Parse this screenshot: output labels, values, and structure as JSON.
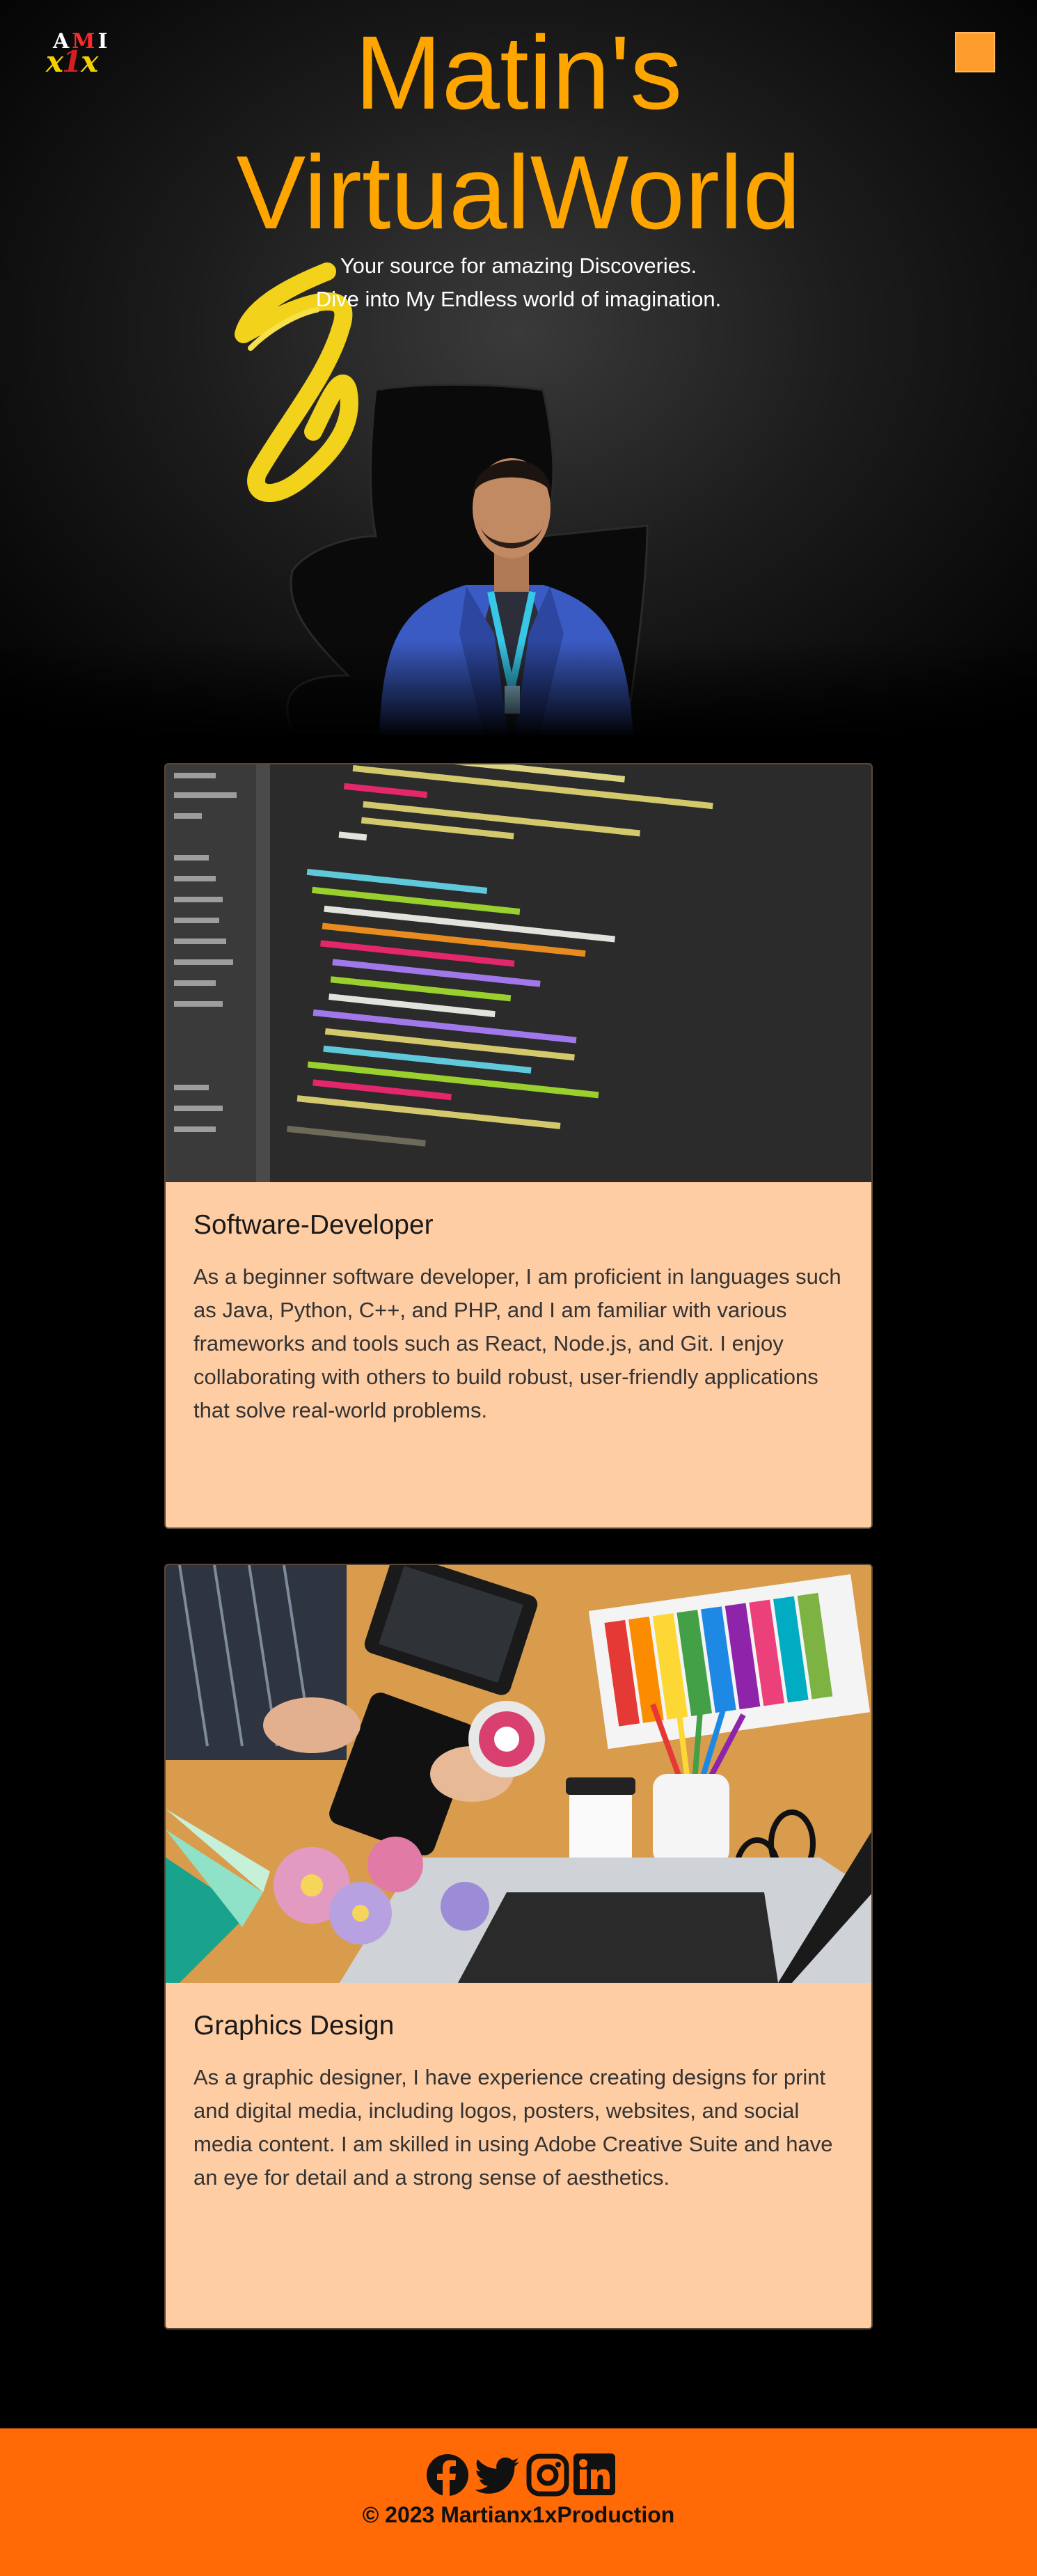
{
  "header": {
    "logo": {
      "top_letters": [
        "A",
        "M",
        "I"
      ],
      "bottom_letters": [
        "x",
        "1",
        "x"
      ]
    },
    "title_line1": "Matin's",
    "title_line2": "VirtualWorld",
    "tagline_line1": "Your source for amazing Discoveries.",
    "tagline_line2": "Dive into My Endless world of imagination.",
    "menu_icon": "hamburger-menu-icon",
    "accent_color": "#ffa500"
  },
  "cards": [
    {
      "image_icon": "code-editor-screenshot",
      "title": "Software-Developer",
      "text": "As a beginner software developer, I am proficient in languages such as Java, Python, C++, and PHP, and I am familiar with various frameworks and tools such as React, Node.js, and Git. I enjoy collaborating with others to build robust, user-friendly applications that solve real-world problems."
    },
    {
      "image_icon": "graphic-design-desk-photo",
      "title": "Graphics Design",
      "text": "As a graphic designer, I have experience creating designs for print and digital media, including logos, posters, websites, and social media content. I am skilled in using Adobe Creative Suite and have an eye for detail and a strong sense of aesthetics."
    }
  ],
  "footer": {
    "social_icons": [
      "facebook-icon",
      "twitter-icon",
      "instagram-icon",
      "linkedin-icon"
    ],
    "copyright": "© 2023 Martianx1xProduction",
    "background_color": "#ff6a06"
  },
  "colors": {
    "card_background": "#ffcda4",
    "page_background": "#000000"
  }
}
